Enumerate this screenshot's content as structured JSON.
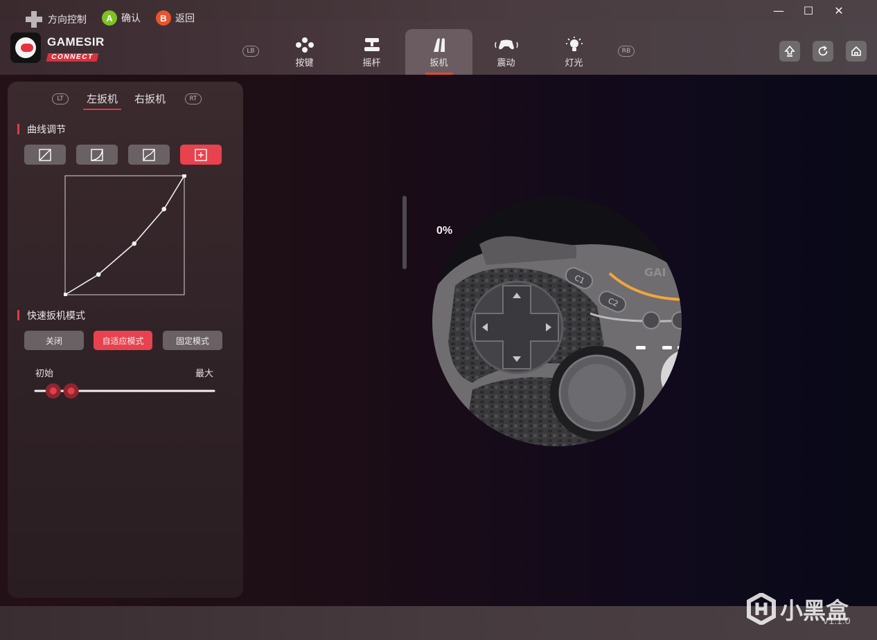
{
  "window": {
    "minimize": "—",
    "maximize": "☐",
    "close": "✕"
  },
  "brand": {
    "name_top": "GAMESIR",
    "name_bottom": "CONNECT"
  },
  "nav": {
    "bumper_left": "LB",
    "bumper_right": "RB",
    "tabs": [
      {
        "label": "按键",
        "icon": "buttons-icon"
      },
      {
        "label": "摇杆",
        "icon": "joystick-icon"
      },
      {
        "label": "扳机",
        "icon": "trigger-icon",
        "active": true
      },
      {
        "label": "震动",
        "icon": "vibration-icon"
      },
      {
        "label": "灯光",
        "icon": "light-bulb-icon"
      }
    ],
    "right_buttons": [
      "upload-icon",
      "reset-icon",
      "home-icon"
    ]
  },
  "panel": {
    "lt_badge": "LT",
    "rt_badge": "RT",
    "trigger_tabs": [
      {
        "label": "左扳机",
        "active": true
      },
      {
        "label": "右扳机",
        "active": false
      }
    ],
    "curve_title": "曲线调节",
    "curve_presets": [
      "linear-curve-icon",
      "ease-out-curve-icon",
      "step-curve-icon",
      "custom-curve-icon"
    ],
    "curve_active_index": 3,
    "curve_points": [
      [
        0,
        0
      ],
      [
        0.28,
        0.17
      ],
      [
        0.58,
        0.43
      ],
      [
        0.83,
        0.72
      ],
      [
        1,
        1
      ]
    ],
    "quick_title": "快速扳机模式",
    "modes": [
      {
        "label": "关闭",
        "active": false
      },
      {
        "label": "自适应模式",
        "active": true
      },
      {
        "label": "固定模式",
        "active": false
      }
    ],
    "slider": {
      "min_label": "初始",
      "max_label": "最大",
      "start": 0.1,
      "end": 0.2
    }
  },
  "preview": {
    "percent": "0%"
  },
  "footer": {
    "hints": [
      {
        "label": "方向控制",
        "icon": "dpad-icon"
      },
      {
        "label": "确认",
        "key": "A",
        "color": "#7cc224"
      },
      {
        "label": "返回",
        "key": "B",
        "color": "#e8542f"
      }
    ]
  },
  "watermark": {
    "text": "小黑盒"
  },
  "version": "V1.1.0",
  "colors": {
    "accent": "#e8424e",
    "tab_underline": "#e8492f"
  }
}
